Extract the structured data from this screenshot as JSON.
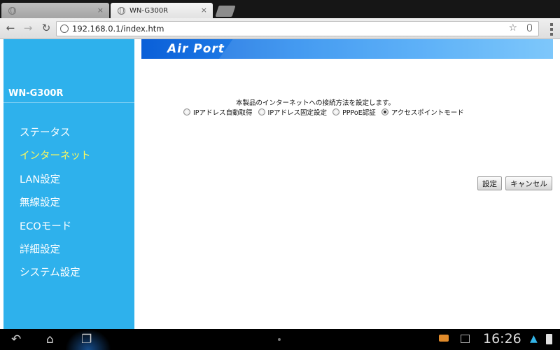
{
  "browser": {
    "tabs": [
      {
        "label": "",
        "active": false
      },
      {
        "label": "WN-G300R",
        "active": true
      }
    ],
    "tab_close_glyph": "×",
    "url": "192.168.0.1/index.htm"
  },
  "router": {
    "banner_logo": "Air Port",
    "model": "WN-G300R",
    "menu": [
      {
        "label": "ステータス",
        "current": false
      },
      {
        "label": "インターネット",
        "current": true
      },
      {
        "label": "LAN設定",
        "current": false
      },
      {
        "label": "無線設定",
        "current": false
      },
      {
        "label": "ECOモード",
        "current": false
      },
      {
        "label": "詳細設定",
        "current": false
      },
      {
        "label": "システム設定",
        "current": false
      }
    ],
    "description": "本製品のインターネットへの接続方法を設定します。",
    "options": [
      {
        "label": "IPアドレス自動取得",
        "checked": false
      },
      {
        "label": "IPアドレス固定設定",
        "checked": false
      },
      {
        "label": "PPPoE認証",
        "checked": false
      },
      {
        "label": "アクセスポイントモード",
        "checked": true
      }
    ],
    "buttons": {
      "set": "設定",
      "cancel": "キャンセル"
    },
    "colors": {
      "sidebar": "#2eb1ec",
      "current_menu": "#fff95a"
    }
  },
  "system_bar": {
    "clock": "16:26"
  }
}
